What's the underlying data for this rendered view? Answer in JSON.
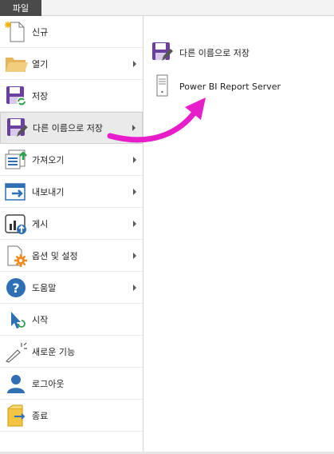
{
  "tabs": {
    "file": "파일"
  },
  "menu": {
    "items": [
      {
        "label": "신규",
        "icon": "new-document-icon",
        "has_submenu": false
      },
      {
        "label": "열기",
        "icon": "open-folder-icon",
        "has_submenu": true
      },
      {
        "label": "저장",
        "icon": "save-icon",
        "has_submenu": false
      },
      {
        "label": "다른 이름으로 저장",
        "icon": "save-as-icon",
        "has_submenu": true,
        "selected": true
      },
      {
        "label": "가져오기",
        "icon": "import-icon",
        "has_submenu": true
      },
      {
        "label": "내보내기",
        "icon": "export-icon",
        "has_submenu": true
      },
      {
        "label": "게시",
        "icon": "publish-icon",
        "has_submenu": true
      },
      {
        "label": "옵션 및 설정",
        "icon": "options-settings-icon",
        "has_submenu": true
      },
      {
        "label": "도움말",
        "icon": "help-icon",
        "has_submenu": true
      },
      {
        "label": "시작",
        "icon": "getting-started-icon",
        "has_submenu": false
      },
      {
        "label": "새로운 기능",
        "icon": "whats-new-icon",
        "has_submenu": false
      },
      {
        "label": "로그아웃",
        "icon": "sign-out-icon",
        "has_submenu": false
      },
      {
        "label": "종료",
        "icon": "exit-icon",
        "has_submenu": false
      }
    ]
  },
  "submenu": {
    "items": [
      {
        "label": "다른 이름으로 저장",
        "icon": "save-as-icon"
      },
      {
        "label": "Power BI Report Server",
        "icon": "report-server-icon"
      }
    ]
  },
  "colors": {
    "accent_purple": "#6b3fa0",
    "pointer_arrow": "#e61dc9",
    "file_tab_bg": "#4a4a4a"
  }
}
